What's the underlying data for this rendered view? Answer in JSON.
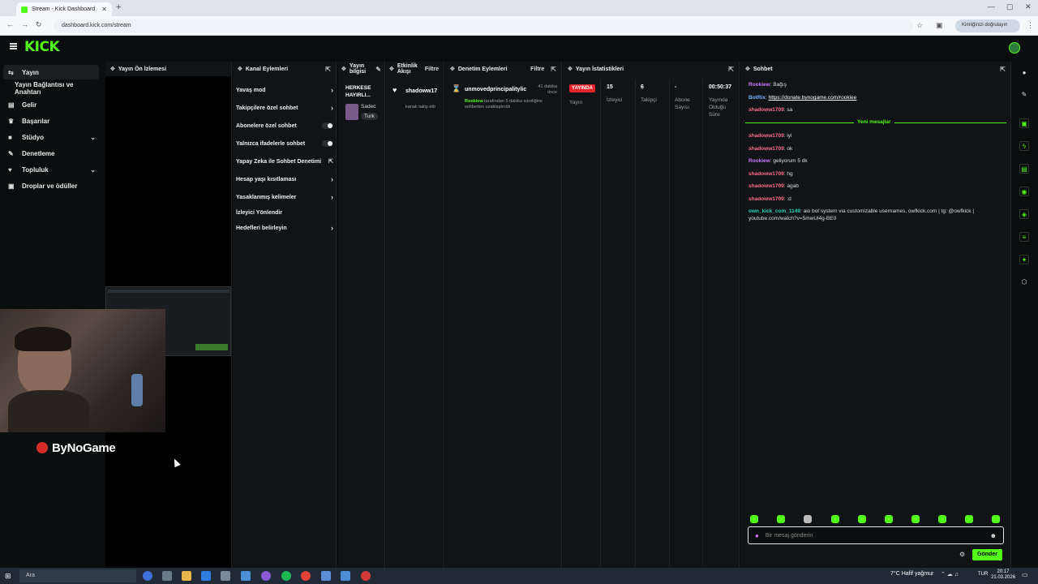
{
  "browser": {
    "tab_title": "Stream - Kick Dashboard",
    "url": "dashboard.kick.com/stream",
    "profile_label": "Kimliğinizi doğrulayın"
  },
  "header": {
    "logo": "KICK"
  },
  "sidebar": {
    "items": [
      {
        "label": "Yayın",
        "icon": "broadcast-icon"
      },
      {
        "label": "Yayın Bağlantısı ve Anahtarı",
        "icon": ""
      },
      {
        "label": "Gelir",
        "icon": "wallet-icon"
      },
      {
        "label": "Başarılar",
        "icon": "trophy-icon"
      },
      {
        "label": "Stüdyo",
        "icon": "camera-icon"
      },
      {
        "label": "Denetleme",
        "icon": "hammer-icon"
      },
      {
        "label": "Topluluk",
        "icon": "community-icon"
      },
      {
        "label": "Droplar ve ödüller",
        "icon": "gift-icon"
      }
    ]
  },
  "preview": {
    "title": "Yayın Ön İzlemesi",
    "watermark": "ByNoGame"
  },
  "actions": {
    "title": "Kanal Eylemleri",
    "rows": [
      {
        "label": "Yavaş mod",
        "kind": "chevron"
      },
      {
        "label": "Takipçilere özel sohbet",
        "kind": "chevron"
      },
      {
        "label": "Abonelere özel sohbet",
        "kind": "toggle"
      },
      {
        "label": "Yalnızca ifadelerle sohbet",
        "kind": "toggle"
      },
      {
        "label": "Yapay Zeka ile Sohbet Denetimi",
        "kind": "external"
      },
      {
        "label": "Hesap yaşı kısıtlaması",
        "kind": "chevron"
      },
      {
        "label": "Yasaklanmış kelimeler",
        "kind": "chevron"
      },
      {
        "label": "İzleyici Yönlendir",
        "kind": "none"
      },
      {
        "label": "Hedefleri belirleyin",
        "kind": "chevron"
      }
    ]
  },
  "info": {
    "title": "Yayın bilgisi",
    "stream_title": "HERKESE HAYIRLI...",
    "tag1": "Sadec",
    "tag2": "Turk"
  },
  "activity": {
    "title": "Etkinlik Akışı",
    "filter": "Filtre",
    "user": "shadoww17",
    "event": "kanalı takip etti"
  },
  "moderation": {
    "title": "Denetim Eylemleri",
    "filter": "Filtre",
    "user": "unmovedprincipalitylic",
    "time": "41 dakika önce",
    "by_user": "Rookiew",
    "detail": "tarafından 5 dakika süreliğine sohbetten uzaklaştırıldı"
  },
  "stats": {
    "title": "Yayın İstatistikleri",
    "badge": "YAYINDA",
    "badge_label": "Yayın",
    "viewers": "15",
    "viewers_label": "İzleyici",
    "followers": "6",
    "followers_label": "Takipçi",
    "subs": "-",
    "subs_label": "Abone Sayısı",
    "duration": "00:50:37",
    "duration_label": "Yayında Olduğu Süre"
  },
  "chat": {
    "title": "Sohbet",
    "messages": [
      {
        "user": "Rookiew",
        "color": "purple",
        "text": "Bağış"
      },
      {
        "user": "BotRix",
        "color": "blue",
        "text": "https://donate.bynogame.com/rookiee",
        "link": true
      },
      {
        "user": "shadoww1709",
        "color": "red",
        "text": "sa"
      },
      {
        "user": "shadoww1709",
        "color": "red",
        "text": "iyi"
      },
      {
        "user": "shadoww1709",
        "color": "red",
        "text": "ok"
      },
      {
        "user": "Rookiew",
        "color": "purple",
        "text": "geliyorum 5 dk"
      },
      {
        "user": "shadoww1709",
        "color": "red",
        "text": "hg"
      },
      {
        "user": "shadoww1709",
        "color": "red",
        "text": "agab"
      },
      {
        "user": "shadoww1709",
        "color": "red",
        "text": ":d"
      },
      {
        "user": "own_kick_com_1149",
        "color": "teal",
        "text": "aio bot system via customizable usernames, owfkick.com | tg: @owfkick | youtube.com/watch?v=5mwUl4g-BE0"
      }
    ],
    "new_messages": "Yeni mesajlar",
    "placeholder": "Bir mesaj gönderin",
    "send": "Gönder"
  },
  "taskbar": {
    "search": "Ara",
    "weather": "7°C Hafif yağmur",
    "lang": "TUR",
    "time": "20:17",
    "date": "21.03.2026"
  }
}
